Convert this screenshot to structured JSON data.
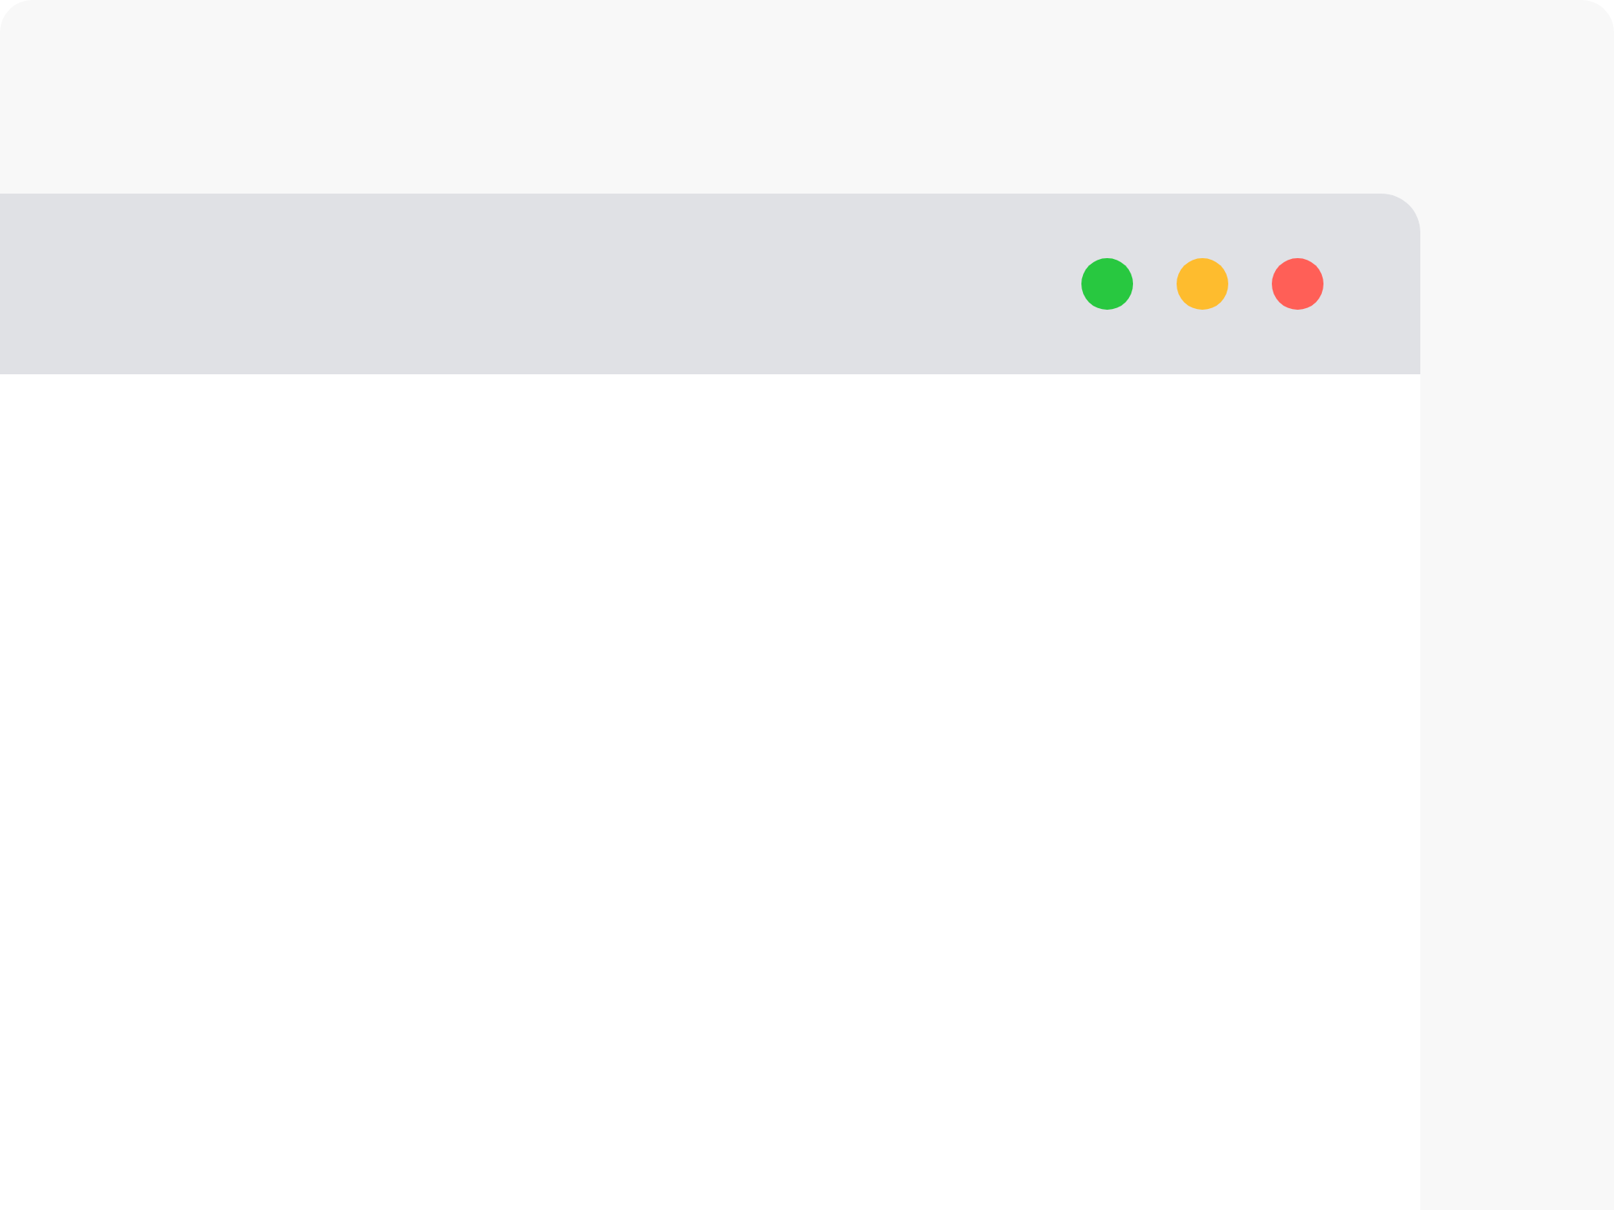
{
  "window": {
    "controls": [
      {
        "color": "#28c840"
      },
      {
        "color": "#febc2e"
      },
      {
        "color": "#ff5f57"
      }
    ]
  }
}
